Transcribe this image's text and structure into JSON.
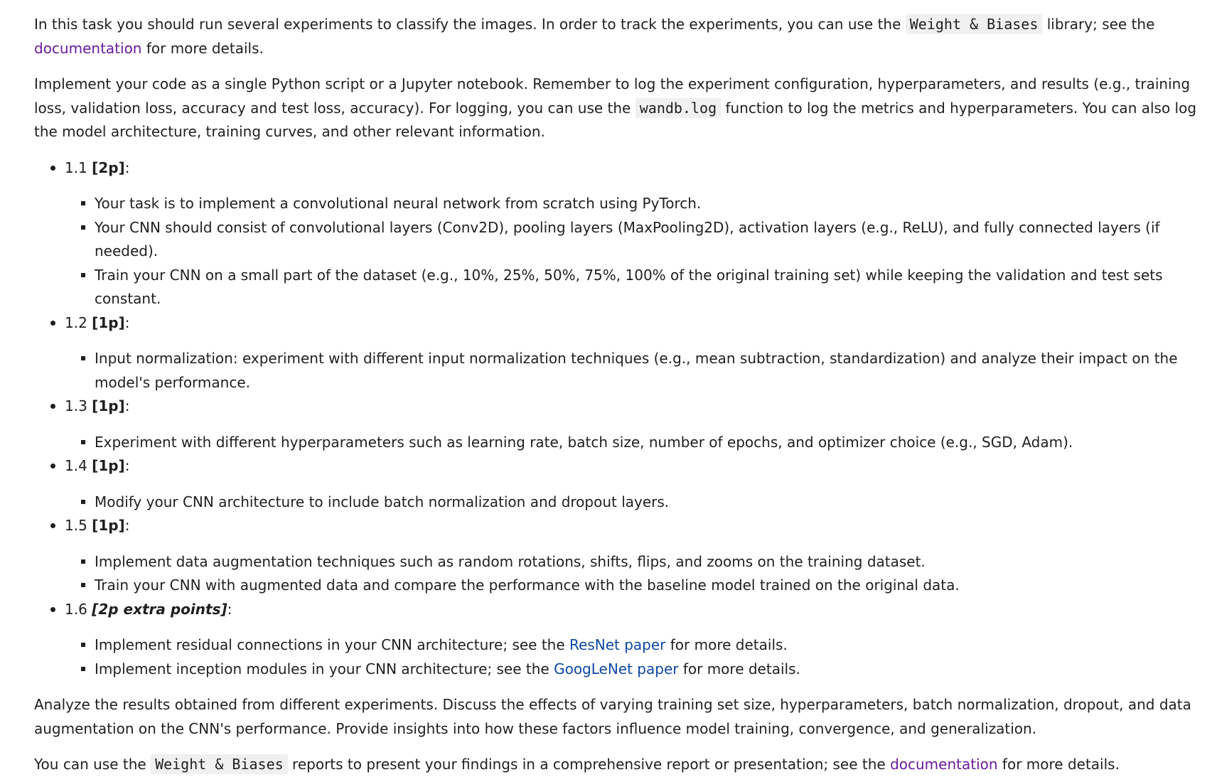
{
  "intro": {
    "p1_text1": "In this task you should run several experiments to classify the images. In order to track the experiments, you can use the ",
    "p1_code": "Weight & Biases",
    "p1_text2": " library; see the ",
    "p1_link": "documentation",
    "p1_text3": " for more details.",
    "p2_text1": "Implement your code as a single Python script or a Jupyter notebook. Remember to log the experiment configuration, hyperparameters, and results (e.g., training loss, validation loss, accuracy and test loss, accuracy). For logging, you can use the ",
    "p2_code": "wandb.log",
    "p2_text2": " function to log the metrics and hyperparameters. You can also log the model architecture, training curves, and other relevant information."
  },
  "tasks": [
    {
      "number": "1.1 ",
      "points": "[2p]",
      "colon": ":",
      "bullets": [
        "Your task is to implement a convolutional neural network from scratch using PyTorch.",
        "Your CNN should consist of convolutional layers (Conv2D), pooling layers (MaxPooling2D), activation layers (e.g., ReLU), and fully connected layers (if needed).",
        "Train your CNN on a small part of the dataset (e.g., 10%, 25%, 50%, 75%, 100% of the original training set) while keeping the validation and test sets constant."
      ]
    },
    {
      "number": "1.2 ",
      "points": "[1p]",
      "colon": ":",
      "bullets": [
        "Input normalization: experiment with different input normalization techniques (e.g., mean subtraction, standardization) and analyze their impact on the model's performance."
      ]
    },
    {
      "number": "1.3 ",
      "points": "[1p]",
      "colon": ":",
      "bullets": [
        "Experiment with different hyperparameters such as learning rate, batch size, number of epochs, and optimizer choice (e.g., SGD, Adam)."
      ]
    },
    {
      "number": "1.4 ",
      "points": "[1p]",
      "colon": ":",
      "bullets": [
        "Modify your CNN architecture to include batch normalization and dropout layers."
      ]
    },
    {
      "number": "1.5 ",
      "points": "[1p]",
      "colon": ":",
      "bullets": [
        "Implement data augmentation techniques such as random rotations, shifts, flips, and zooms on the training dataset.",
        "Train your CNN with augmented data and compare the performance with the baseline model trained on the original data."
      ]
    },
    {
      "number": "1.6 ",
      "points": "[2p extra points]",
      "colon": ":",
      "bullet1_text1": "Implement residual connections in your CNN architecture; see the ",
      "bullet1_link": "ResNet paper",
      "bullet1_text2": " for more details.",
      "bullet2_text1": "Implement inception modules in your CNN architecture; see the ",
      "bullet2_link": "GoogLeNet paper",
      "bullet2_text2": " for more details."
    }
  ],
  "outro": {
    "p3_text": "Analyze the results obtained from different experiments. Discuss the effects of varying training set size, hyperparameters, batch normalization, dropout, and data augmentation on the CNN's performance. Provide insights into how these factors influence model training, convergence, and generalization.",
    "p4_text1": "You can use the ",
    "p4_code": "Weight & Biases",
    "p4_text2": " reports to present your findings in a comprehensive report or presentation; see the ",
    "p4_link": "documentation",
    "p4_text3": " for more details."
  },
  "colors": {
    "text": "#1f1f1f",
    "visited_link": "#6a1b9a",
    "link": "#0d47a1",
    "code_bg": "#f0f0f0"
  }
}
